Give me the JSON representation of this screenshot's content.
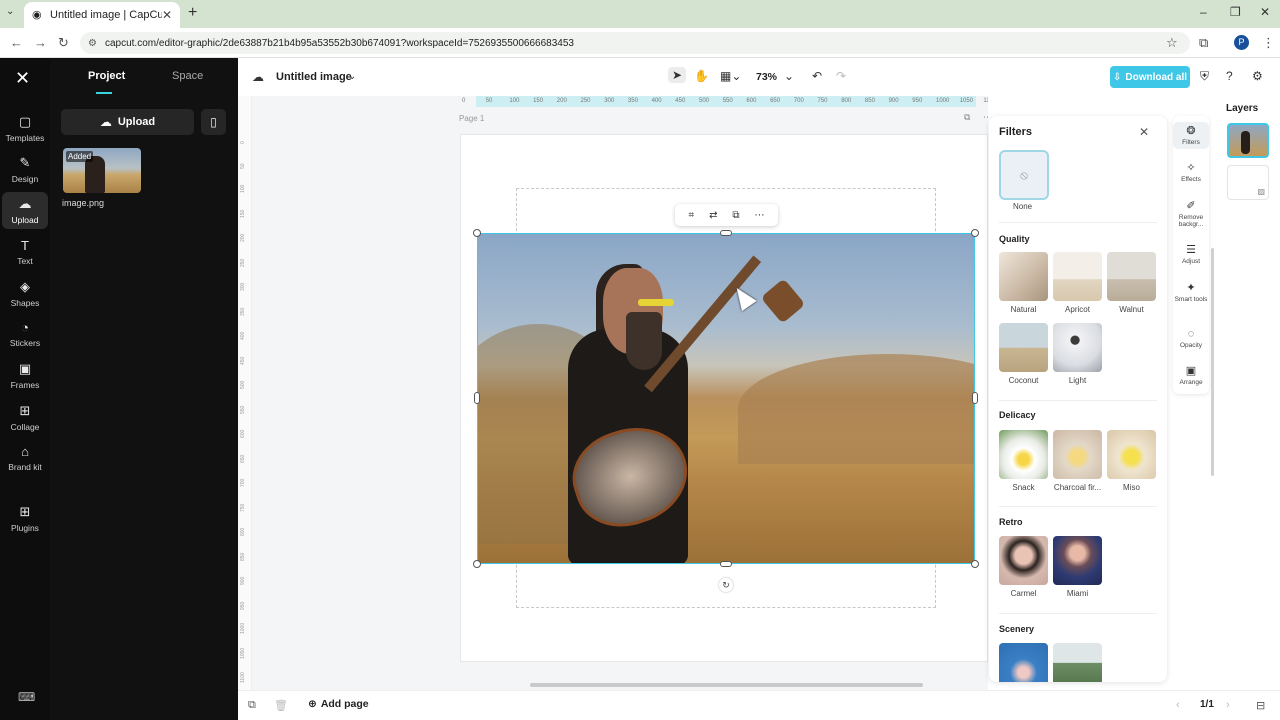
{
  "browser": {
    "tab_title": "Untitled image | CapCut",
    "url": "capcut.com/editor-graphic/2de63887b21b4b95a53552b30b674091?workspaceId=7526935500666683453",
    "profile_initial": "P"
  },
  "rail": {
    "items": [
      {
        "label": "Templates"
      },
      {
        "label": "Design"
      },
      {
        "label": "Upload"
      },
      {
        "label": "Text"
      },
      {
        "label": "Shapes"
      },
      {
        "label": "Stickers"
      },
      {
        "label": "Frames"
      },
      {
        "label": "Collage"
      },
      {
        "label": "Brand kit"
      },
      {
        "label": "Plugins"
      }
    ],
    "active": "Upload"
  },
  "left_panel": {
    "tabs": {
      "project": "Project",
      "space": "Space"
    },
    "upload_label": "Upload",
    "asset": {
      "badge": "Added",
      "name": "image.png"
    }
  },
  "toolbar": {
    "doc_title": "Untitled image",
    "zoom": "73%",
    "download_label": "Download all"
  },
  "canvas": {
    "page_label": "Page 1",
    "hruler": [
      "0",
      "50",
      "100",
      "150",
      "200",
      "250",
      "300",
      "350",
      "400",
      "450",
      "500",
      "550",
      "600",
      "650",
      "700",
      "750",
      "800",
      "850",
      "900",
      "950",
      "1000",
      "1050",
      "1100"
    ],
    "vruler": [
      "0",
      "50",
      "100",
      "150",
      "200",
      "250",
      "300",
      "350",
      "400",
      "450",
      "500",
      "550",
      "600",
      "650",
      "700",
      "750",
      "800",
      "850",
      "900",
      "950",
      "1000",
      "1050",
      "1100"
    ]
  },
  "filters": {
    "title": "Filters",
    "none_label": "None",
    "sections": {
      "quality": "Quality",
      "delicacy": "Delicacy",
      "retro": "Retro",
      "scenery": "Scenery"
    },
    "quality": [
      "Natural",
      "Apricot",
      "Walnut",
      "Coconut",
      "Light"
    ],
    "delicacy": [
      "Snack",
      "Charcoal fir...",
      "Miso"
    ],
    "retro": [
      "Carmel",
      "Miami"
    ]
  },
  "right_tools": {
    "filters": "Filters",
    "effects": "Effects",
    "remove_bg": "Remove backgr...",
    "adjust": "Adjust",
    "smart_tools": "Smart tools",
    "opacity": "Opacity",
    "arrange": "Arrange"
  },
  "layers": {
    "title": "Layers"
  },
  "bottom": {
    "add_page": "Add page",
    "page_count": "1/1"
  },
  "colors": {
    "accent": "#3ec7e6",
    "rail_bg": "#0d0d0d",
    "panel_bg": "#111111"
  }
}
